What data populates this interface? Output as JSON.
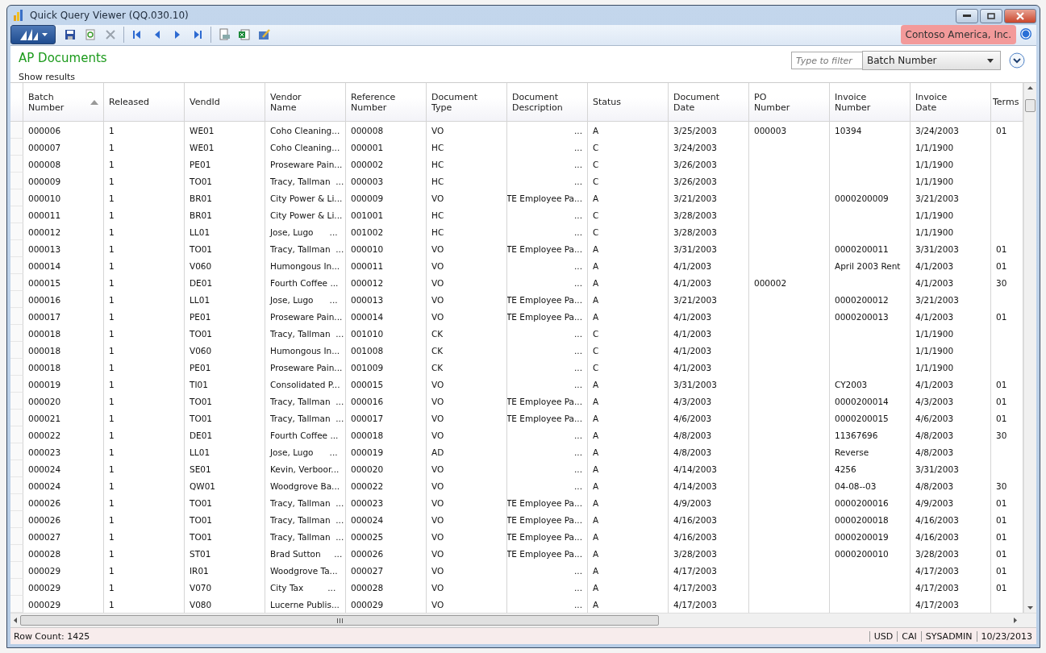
{
  "window": {
    "title": "Quick Query Viewer (QQ.030.10)"
  },
  "company": "Contoso America, Inc.",
  "page_title": "AP Documents",
  "show_results": "Show results",
  "filter": {
    "placeholder": "Type to filter",
    "field": "Batch Number"
  },
  "table": {
    "columns": [
      {
        "label": "Batch Number",
        "sorted": true,
        "kind": "text"
      },
      {
        "label": "Released",
        "sorted": false,
        "kind": "text"
      },
      {
        "label": "VendId",
        "sorted": false,
        "kind": "text"
      },
      {
        "label": "Vendor Name",
        "sorted": false,
        "kind": "text"
      },
      {
        "label": "Reference Number",
        "sorted": false,
        "kind": "text"
      },
      {
        "label": "Document Type",
        "sorted": false,
        "kind": "text"
      },
      {
        "label": "Document Description",
        "sorted": false,
        "kind": "memo"
      },
      {
        "label": "Status",
        "sorted": false,
        "kind": "text"
      },
      {
        "label": "Document Date",
        "sorted": false,
        "kind": "text"
      },
      {
        "label": "PO Number",
        "sorted": false,
        "kind": "text"
      },
      {
        "label": "Invoice Number",
        "sorted": false,
        "kind": "text"
      },
      {
        "label": "Invoice Date",
        "sorted": false,
        "kind": "text"
      },
      {
        "label": "Terms",
        "sorted": false,
        "kind": "text"
      }
    ],
    "rows": [
      [
        "000006",
        "1",
        "WE01",
        "Coho Cleaning...",
        "000008",
        "VO",
        "...",
        "A",
        "3/25/2003",
        "000003",
        "10394",
        "3/24/2003",
        "01"
      ],
      [
        "000007",
        "1",
        "WE01",
        "Coho Cleaning...",
        "000001",
        "HC",
        "...",
        "C",
        "3/24/2003",
        null,
        null,
        "1/1/1900",
        null
      ],
      [
        "000008",
        "1",
        "PE01",
        "Proseware Pain...",
        "000002",
        "HC",
        "...",
        "C",
        "3/26/2003",
        null,
        null,
        "1/1/1900",
        null
      ],
      [
        "000009",
        "1",
        "TO01",
        "Tracy, Tallman  ...",
        "000003",
        "HC",
        "...",
        "C",
        "3/26/2003",
        null,
        null,
        "1/1/1900",
        null
      ],
      [
        "000010",
        "1",
        "BR01",
        "City Power & Li...",
        "000009",
        "VO",
        "TE Employee Pa...",
        "A",
        "3/21/2003",
        null,
        "0000200009",
        "3/21/2003",
        null
      ],
      [
        "000011",
        "1",
        "BR01",
        "City Power & Li...",
        "001001",
        "HC",
        "...",
        "C",
        "3/28/2003",
        null,
        null,
        "1/1/1900",
        null
      ],
      [
        "000012",
        "1",
        "LL01",
        "Jose, Lugo      ...",
        "001002",
        "HC",
        "...",
        "C",
        "3/28/2003",
        null,
        null,
        "1/1/1900",
        null
      ],
      [
        "000013",
        "1",
        "TO01",
        "Tracy, Tallman  ...",
        "000010",
        "VO",
        "TE Employee Pa...",
        "A",
        "3/31/2003",
        null,
        "0000200011",
        "3/31/2003",
        "01"
      ],
      [
        "000014",
        "1",
        "V060",
        "Humongous In...",
        "000011",
        "VO",
        "...",
        "A",
        "4/1/2003",
        null,
        "April 2003 Rent",
        "4/1/2003",
        "01"
      ],
      [
        "000015",
        "1",
        "DE01",
        "Fourth Coffee ...",
        "000012",
        "VO",
        "...",
        "A",
        "4/1/2003",
        "000002",
        null,
        "4/1/2003",
        "30"
      ],
      [
        "000016",
        "1",
        "LL01",
        "Jose, Lugo      ...",
        "000013",
        "VO",
        "TE Employee Pa...",
        "A",
        "3/21/2003",
        null,
        "0000200012",
        "3/21/2003",
        null
      ],
      [
        "000017",
        "1",
        "PE01",
        "Proseware Pain...",
        "000014",
        "VO",
        "TE Employee Pa...",
        "A",
        "4/1/2003",
        null,
        "0000200013",
        "4/1/2003",
        "01"
      ],
      [
        "000018",
        "1",
        "TO01",
        "Tracy, Tallman  ...",
        "001010",
        "CK",
        "...",
        "C",
        "4/1/2003",
        null,
        null,
        "1/1/1900",
        null
      ],
      [
        "000018",
        "1",
        "V060",
        "Humongous In...",
        "001008",
        "CK",
        "...",
        "C",
        "4/1/2003",
        null,
        null,
        "1/1/1900",
        null
      ],
      [
        "000018",
        "1",
        "PE01",
        "Proseware Pain...",
        "001009",
        "CK",
        "...",
        "C",
        "4/1/2003",
        null,
        null,
        "1/1/1900",
        null
      ],
      [
        "000019",
        "1",
        "TI01",
        "Consolidated P...",
        "000015",
        "VO",
        "...",
        "A",
        "3/31/2003",
        null,
        "CY2003",
        "4/1/2003",
        "01"
      ],
      [
        "000020",
        "1",
        "TO01",
        "Tracy, Tallman  ...",
        "000016",
        "VO",
        "TE Employee Pa...",
        "A",
        "4/3/2003",
        null,
        "0000200014",
        "4/3/2003",
        "01"
      ],
      [
        "000021",
        "1",
        "TO01",
        "Tracy, Tallman  ...",
        "000017",
        "VO",
        "TE Employee Pa...",
        "A",
        "4/6/2003",
        null,
        "0000200015",
        "4/6/2003",
        "01"
      ],
      [
        "000022",
        "1",
        "DE01",
        "Fourth Coffee ...",
        "000018",
        "VO",
        "...",
        "A",
        "4/8/2003",
        null,
        "11367696",
        "4/8/2003",
        "30"
      ],
      [
        "000023",
        "1",
        "LL01",
        "Jose, Lugo      ...",
        "000019",
        "AD",
        "...",
        "A",
        "4/8/2003",
        null,
        "Reverse",
        "4/8/2003",
        null
      ],
      [
        "000024",
        "1",
        "SE01",
        "Kevin, Verboor...",
        "000020",
        "VO",
        "...",
        "A",
        "4/14/2003",
        null,
        "4256",
        "3/31/2003",
        null
      ],
      [
        "000024",
        "1",
        "QW01",
        "Woodgrove Ba...",
        "000022",
        "VO",
        "...",
        "A",
        "4/14/2003",
        null,
        "04-08--03",
        "4/8/2003",
        "30"
      ],
      [
        "000026",
        "1",
        "TO01",
        "Tracy, Tallman  ...",
        "000023",
        "VO",
        "TE Employee Pa...",
        "A",
        "4/9/2003",
        null,
        "0000200016",
        "4/9/2003",
        "01"
      ],
      [
        "000026",
        "1",
        "TO01",
        "Tracy, Tallman  ...",
        "000024",
        "VO",
        "TE Employee Pa...",
        "A",
        "4/16/2003",
        null,
        "0000200018",
        "4/16/2003",
        "01"
      ],
      [
        "000027",
        "1",
        "TO01",
        "Tracy, Tallman  ...",
        "000025",
        "VO",
        "TE Employee Pa...",
        "A",
        "4/16/2003",
        null,
        "0000200019",
        "4/16/2003",
        "01"
      ],
      [
        "000028",
        "1",
        "ST01",
        "Brad Sutton     ...",
        "000026",
        "VO",
        "TE Employee Pa...",
        "A",
        "3/28/2003",
        null,
        "0000200010",
        "3/28/2003",
        "01"
      ],
      [
        "000029",
        "1",
        "IR01",
        "Woodgrove Ta...",
        "000027",
        "VO",
        "...",
        "A",
        "4/17/2003",
        null,
        null,
        "4/17/2003",
        "01"
      ],
      [
        "000029",
        "1",
        "V070",
        "City Tax         ...",
        "000028",
        "VO",
        "...",
        "A",
        "4/17/2003",
        null,
        null,
        "4/17/2003",
        "01"
      ],
      [
        "000029",
        "1",
        "V080",
        "Lucerne Publis...",
        "000029",
        "VO",
        "...",
        "A",
        "4/17/2003",
        null,
        null,
        "4/17/2003",
        null
      ]
    ]
  },
  "status_bar": {
    "row_count": "Row Count: 1425",
    "fields": [
      "USD",
      "CAI",
      "SYSADMIN",
      "10/23/2013"
    ]
  }
}
